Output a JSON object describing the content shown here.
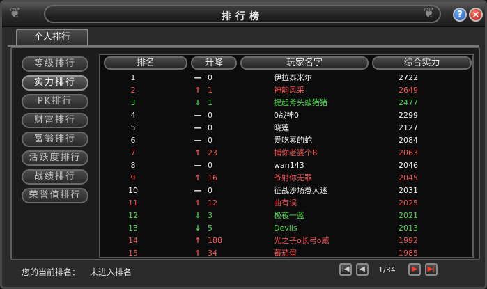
{
  "window": {
    "title": "排行榜"
  },
  "titlebar_buttons": {
    "help_label": "?",
    "close_label": "×"
  },
  "tabs": [
    {
      "label": "个人排行"
    }
  ],
  "sidebar": {
    "items": [
      {
        "label": "等级排行",
        "active": false
      },
      {
        "label": "实力排行",
        "active": true
      },
      {
        "label": "PK排行",
        "active": false
      },
      {
        "label": "财富排行",
        "active": false
      },
      {
        "label": "富翁排行",
        "active": false
      },
      {
        "label": "活跃度排行",
        "active": false
      },
      {
        "label": "战绩排行",
        "active": false
      },
      {
        "label": "荣誉值排行",
        "active": false
      }
    ]
  },
  "table": {
    "headers": [
      "排名",
      "升降",
      "玩家名字",
      "综合实力"
    ],
    "rows": [
      {
        "rank": "1",
        "trend": "flat",
        "delta": "0",
        "name": "伊拉泰米尔",
        "score": "2722",
        "color": "white"
      },
      {
        "rank": "2",
        "trend": "up",
        "delta": "1",
        "name": "神韵风采",
        "score": "2649",
        "color": "red"
      },
      {
        "rank": "3",
        "trend": "down",
        "delta": "1",
        "name": "提起斧头敲猪猪",
        "score": "2477",
        "color": "green"
      },
      {
        "rank": "4",
        "trend": "flat",
        "delta": "0",
        "name": "0战神0",
        "score": "2299",
        "color": "white"
      },
      {
        "rank": "5",
        "trend": "flat",
        "delta": "0",
        "name": "晓莲",
        "score": "2127",
        "color": "white"
      },
      {
        "rank": "6",
        "trend": "flat",
        "delta": "0",
        "name": "爱吃素的蛇",
        "score": "2084",
        "color": "white"
      },
      {
        "rank": "7",
        "trend": "up",
        "delta": "23",
        "name": "捕你老婆个B",
        "score": "2063",
        "color": "red"
      },
      {
        "rank": "8",
        "trend": "flat",
        "delta": "0",
        "name": "wan143",
        "score": "2046",
        "color": "white"
      },
      {
        "rank": "9",
        "trend": "up",
        "delta": "16",
        "name": "爷射你无罪",
        "score": "2045",
        "color": "red"
      },
      {
        "rank": "10",
        "trend": "flat",
        "delta": "0",
        "name": "征战沙场惹人迷",
        "score": "2031",
        "color": "white"
      },
      {
        "rank": "11",
        "trend": "up",
        "delta": "12",
        "name": "曲有误",
        "score": "2025",
        "color": "red"
      },
      {
        "rank": "12",
        "trend": "down",
        "delta": "3",
        "name": "极夜一蓝",
        "score": "2021",
        "color": "green"
      },
      {
        "rank": "13",
        "trend": "down",
        "delta": "5",
        "name": "Devils",
        "score": "2013",
        "color": "green"
      },
      {
        "rank": "14",
        "trend": "up",
        "delta": "188",
        "name": "光之子o长弓o威",
        "score": "1992",
        "color": "red"
      },
      {
        "rank": "15",
        "trend": "up",
        "delta": "34",
        "name": "蕃茄蛋",
        "score": "1985",
        "color": "red"
      }
    ]
  },
  "footer": {
    "current_rank_label": "您的当前排名：",
    "current_rank_value": "未进入排名",
    "page_indicator": "1/34"
  },
  "pager_icons": {
    "first": "first-page-icon",
    "prev": "prev-page-icon",
    "next": "next-page-icon",
    "last": "last-page-icon"
  },
  "colors": {
    "rank_up": "#f05252",
    "rank_down": "#4cd84c",
    "rank_flat": "#f0f0f0",
    "background": "#1c1c1c"
  }
}
